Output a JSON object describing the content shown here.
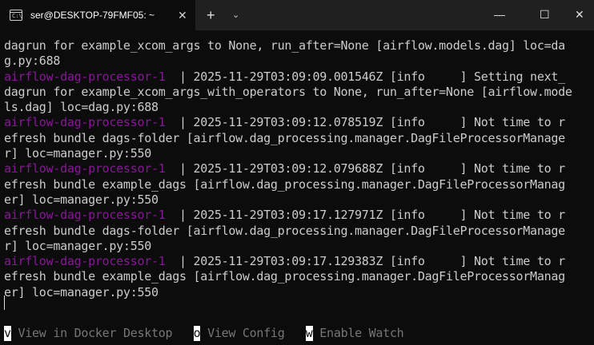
{
  "window": {
    "tab_title": "ser@DESKTOP-79FMF05: ~",
    "tab_icon_glyph": "C:\\",
    "close_tab_glyph": "✕",
    "new_tab_glyph": "+",
    "dropdown_glyph": "⌄",
    "minimize_glyph": "—",
    "maximize_glyph": "☐",
    "close_glyph": "✕"
  },
  "terminal": {
    "lines": [
      {
        "prefix": "",
        "text": "dagrun for example_xcom_args to None, run_after=None [airflow.models.dag] loc=da"
      },
      {
        "prefix": "",
        "text": "g.py:688"
      },
      {
        "prefix": "airflow-dag-processor-1",
        "text": "  | 2025-11-29T03:09:09.001546Z [info     ] Setting next_"
      },
      {
        "prefix": "",
        "text": "dagrun for example_xcom_args_with_operators to None, run_after=None [airflow.mode"
      },
      {
        "prefix": "",
        "text": "ls.dag] loc=dag.py:688"
      },
      {
        "prefix": "airflow-dag-processor-1",
        "text": "  | 2025-11-29T03:09:12.078519Z [info     ] Not time to r"
      },
      {
        "prefix": "",
        "text": "efresh bundle dags-folder [airflow.dag_processing.manager.DagFileProcessorManage"
      },
      {
        "prefix": "",
        "text": "r] loc=manager.py:550"
      },
      {
        "prefix": "airflow-dag-processor-1",
        "text": "  | 2025-11-29T03:09:12.079688Z [info     ] Not time to r"
      },
      {
        "prefix": "",
        "text": "efresh bundle example_dags [airflow.dag_processing.manager.DagFileProcessorManag"
      },
      {
        "prefix": "",
        "text": "er] loc=manager.py:550"
      },
      {
        "prefix": "airflow-dag-processor-1",
        "text": "  | 2025-11-29T03:09:17.127971Z [info     ] Not time to r"
      },
      {
        "prefix": "",
        "text": "efresh bundle dags-folder [airflow.dag_processing.manager.DagFileProcessorManage"
      },
      {
        "prefix": "",
        "text": "r] loc=manager.py:550"
      },
      {
        "prefix": "airflow-dag-processor-1",
        "text": "  | 2025-11-29T03:09:17.129383Z [info     ] Not time to r"
      },
      {
        "prefix": "",
        "text": "efresh bundle example_dags [airflow.dag_processing.manager.DagFileProcessorManag"
      },
      {
        "prefix": "",
        "text": "er] loc=manager.py:550"
      }
    ]
  },
  "bottom_bar": {
    "items": [
      {
        "key": "v",
        "label": " View in Docker Desktop"
      },
      {
        "key": "o",
        "label": " View Config"
      },
      {
        "key": "w",
        "label": " Enable Watch"
      }
    ]
  },
  "colors": {
    "background": "#0c0c0c",
    "titlebar": "#202020",
    "text": "#cccccc",
    "process_prefix": "#881798",
    "muted": "#767676"
  }
}
